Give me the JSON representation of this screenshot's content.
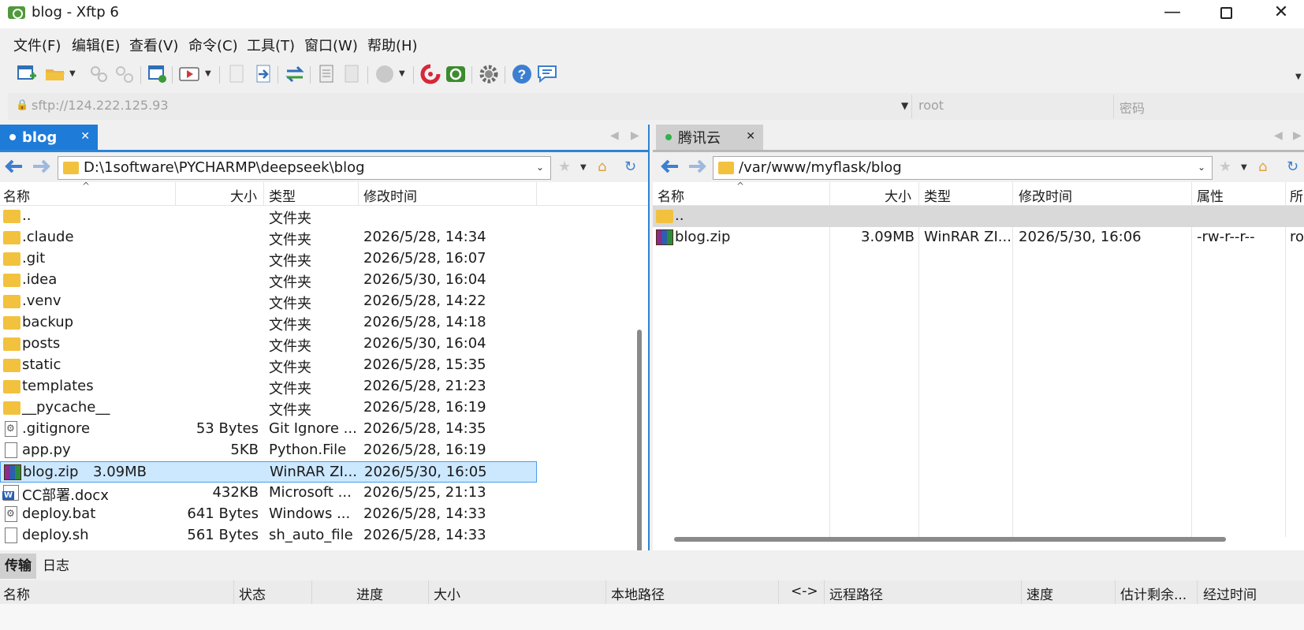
{
  "window": {
    "title": "blog - Xftp 6",
    "minimize": "—",
    "close": "✕"
  },
  "menu": [
    "文件(F)",
    "编辑(E)",
    "查看(V)",
    "命令(C)",
    "工具(T)",
    "窗口(W)",
    "帮助(H)"
  ],
  "toolbar": {
    "icons": [
      "new-session-icon",
      "open-folder-icon",
      "link-icon",
      "unlink-icon",
      "session-settings-icon",
      "play-icon",
      "copy-local-icon",
      "transfer-right-icon",
      "sync-icon",
      "doc-icon",
      "doc2-icon",
      "circle-icon",
      "xshell-icon",
      "xftp-icon",
      "gear-icon",
      "help-icon",
      "chat-icon"
    ]
  },
  "address": {
    "host": "sftp://124.222.125.93",
    "user": "root",
    "password": "密码"
  },
  "left": {
    "tab": "blog",
    "path": "D:\\1software\\PYCHARMP\\deepseek\\blog",
    "columns": [
      "名称",
      "大小",
      "类型",
      "修改时间"
    ],
    "rows": [
      {
        "name": "..",
        "size": "",
        "type": "文件夹",
        "modified": "",
        "icon": "folder"
      },
      {
        "name": ".claude",
        "size": "",
        "type": "文件夹",
        "modified": "2026/5/28, 14:34",
        "icon": "folder"
      },
      {
        "name": ".git",
        "size": "",
        "type": "文件夹",
        "modified": "2026/5/28, 16:07",
        "icon": "folder"
      },
      {
        "name": ".idea",
        "size": "",
        "type": "文件夹",
        "modified": "2026/5/30, 16:04",
        "icon": "folder"
      },
      {
        "name": ".venv",
        "size": "",
        "type": "文件夹",
        "modified": "2026/5/28, 14:22",
        "icon": "folder"
      },
      {
        "name": "backup",
        "size": "",
        "type": "文件夹",
        "modified": "2026/5/28, 14:18",
        "icon": "folder"
      },
      {
        "name": "posts",
        "size": "",
        "type": "文件夹",
        "modified": "2026/5/30, 16:04",
        "icon": "folder"
      },
      {
        "name": "static",
        "size": "",
        "type": "文件夹",
        "modified": "2026/5/28, 15:35",
        "icon": "folder"
      },
      {
        "name": "templates",
        "size": "",
        "type": "文件夹",
        "modified": "2026/5/28, 21:23",
        "icon": "folder"
      },
      {
        "name": "__pycache__",
        "size": "",
        "type": "文件夹",
        "modified": "2026/5/28, 16:19",
        "icon": "folder"
      },
      {
        "name": ".gitignore",
        "size": "53 Bytes",
        "type": "Git Ignore ...",
        "modified": "2026/5/28, 14:35",
        "icon": "cfg"
      },
      {
        "name": "app.py",
        "size": "5KB",
        "type": "Python.File",
        "modified": "2026/5/28, 16:19",
        "icon": "file"
      },
      {
        "name": "blog.zip",
        "size": "3.09MB",
        "type": "WinRAR ZI...",
        "modified": "2026/5/30, 16:05",
        "icon": "zip",
        "selected": true
      },
      {
        "name": "CC部署.docx",
        "size": "432KB",
        "type": "Microsoft ...",
        "modified": "2026/5/25, 21:13",
        "icon": "doc"
      },
      {
        "name": "deploy.bat",
        "size": "641 Bytes",
        "type": "Windows ...",
        "modified": "2026/5/28, 14:33",
        "icon": "cfg"
      },
      {
        "name": "deploy.sh",
        "size": "561 Bytes",
        "type": "sh_auto_file",
        "modified": "2026/5/28, 14:33",
        "icon": "file"
      }
    ]
  },
  "right": {
    "tab": "腾讯云",
    "path": "/var/www/myflask/blog",
    "columns": [
      "名称",
      "大小",
      "类型",
      "修改时间",
      "属性",
      "所"
    ],
    "rows": [
      {
        "name": "..",
        "size": "",
        "type": "",
        "modified": "",
        "attr": "",
        "owner": "",
        "icon": "folder",
        "gray": true
      },
      {
        "name": "blog.zip",
        "size": "3.09MB",
        "type": "WinRAR ZI...",
        "modified": "2026/5/30, 16:06",
        "attr": "-rw-r--r--",
        "owner": "ro",
        "icon": "zip"
      }
    ]
  },
  "transfer": {
    "tabs": [
      "传输",
      "日志"
    ],
    "columns": [
      "名称",
      "状态",
      "进度",
      "大小",
      "本地路径",
      "<->",
      "远程路径",
      "速度",
      "估计剩余...",
      "经过时间"
    ]
  },
  "colors": {
    "accent": "#1f7bd8",
    "selection": "#cce8ff",
    "folder": "#f2c23e"
  }
}
